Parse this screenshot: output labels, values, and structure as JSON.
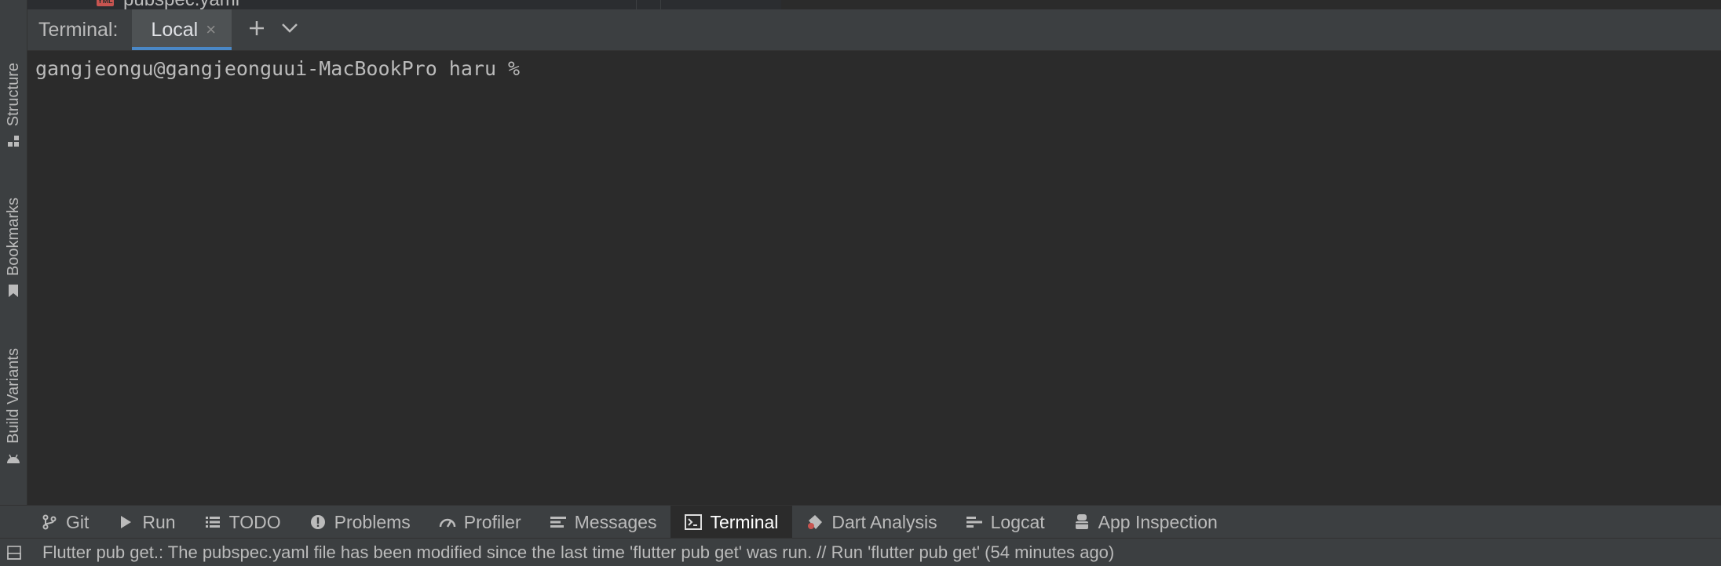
{
  "top_strip": {
    "file_name": "pubspec.yaml",
    "file_icon_text": "YML"
  },
  "left_stripe": {
    "tabs": [
      {
        "label": "Structure",
        "icon": "structure-icon"
      },
      {
        "label": "Bookmarks",
        "icon": "bookmark-icon"
      },
      {
        "label": "Build Variants",
        "icon": "android-icon"
      }
    ]
  },
  "terminal": {
    "title": "Terminal:",
    "tab_label": "Local",
    "close_glyph": "×",
    "add_icon": "plus-icon",
    "dropdown_icon": "chevron-down-icon",
    "prompt": "gangjeongu@gangjeonguui-MacBookPro haru %"
  },
  "bottom_tabs": [
    {
      "label": "Git",
      "icon": "git-branch-icon"
    },
    {
      "label": "Run",
      "icon": "play-icon"
    },
    {
      "label": "TODO",
      "icon": "list-icon"
    },
    {
      "label": "Problems",
      "icon": "problems-icon"
    },
    {
      "label": "Profiler",
      "icon": "gauge-icon"
    },
    {
      "label": "Messages",
      "icon": "messages-icon"
    },
    {
      "label": "Terminal",
      "icon": "terminal-icon",
      "active": true
    },
    {
      "label": "Dart Analysis",
      "icon": "dart-analysis-icon"
    },
    {
      "label": "Logcat",
      "icon": "logcat-icon"
    },
    {
      "label": "App Inspection",
      "icon": "app-inspection-icon"
    }
  ],
  "status_bar": {
    "message": "Flutter pub get.: The pubspec.yaml file has been modified since the last time 'flutter pub get' was run. // Run 'flutter pub get' (54 minutes ago)"
  },
  "colors": {
    "background": "#2b2b2b",
    "panel": "#3c3f41",
    "accent": "#4a88c7",
    "text": "#bbbbbb"
  }
}
